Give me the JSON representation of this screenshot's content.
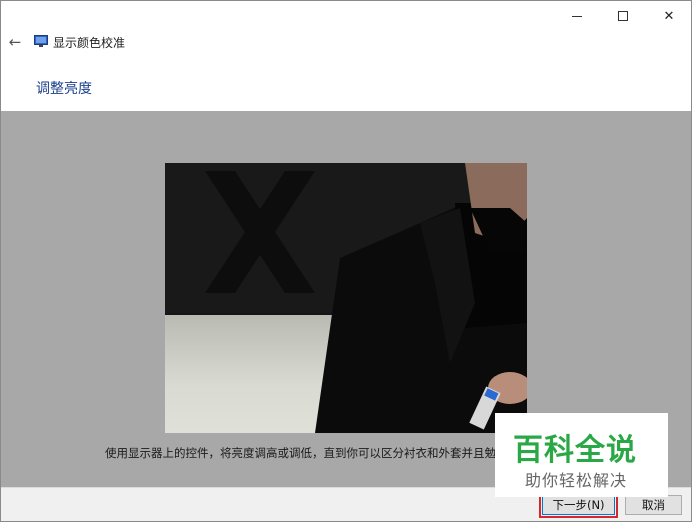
{
  "window": {
    "minimize_label": "—",
    "maximize_label": "☐",
    "close_label": "✕"
  },
  "nav": {
    "back_icon": "←",
    "app_title": "显示颜色校准"
  },
  "page": {
    "heading": "调整亮度",
    "instruction": "使用显示器上的控件，将亮度调高或调低，直到你可以区分衬衣和外套并且勉"
  },
  "buttons": {
    "next": "下一步(N)",
    "cancel": "取消"
  },
  "watermark": {
    "title": "百科全说",
    "subtitle": "助你轻松解决"
  },
  "colors": {
    "heading": "#1b3f8e",
    "content_bg": "#a8a8a8",
    "watermark_green": "#2aa845",
    "next_highlight": "#d9262c"
  }
}
